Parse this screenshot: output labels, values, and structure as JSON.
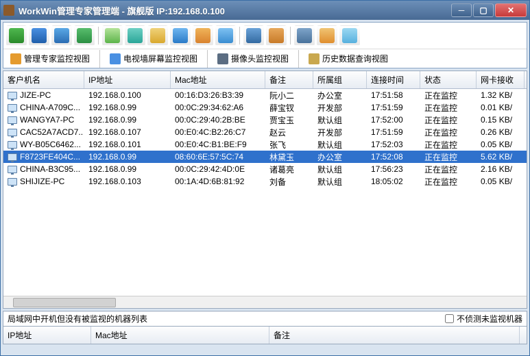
{
  "window": {
    "title": "WorkWin管理专家管理端 - 旗舰版 IP:192.168.0.100"
  },
  "toolbar_icons": [
    {
      "name": "desktop-icon",
      "color": "linear-gradient(#4fb84f,#2a8a2a)"
    },
    {
      "name": "screens-icon",
      "color": "linear-gradient(#4a90e2,#1f5eaa)"
    },
    {
      "name": "monitor-icon",
      "color": "linear-gradient(#5aa8e6,#2b6db3)"
    },
    {
      "name": "camera-icon",
      "color": "linear-gradient(#58bd6d,#2b8f42)"
    },
    {
      "name": "page-green-icon",
      "color": "linear-gradient(#b4e39a,#5db44a)"
    },
    {
      "name": "page-teal-icon",
      "color": "linear-gradient(#6ed0c4,#2aa598)"
    },
    {
      "name": "clipboard-icon",
      "color": "linear-gradient(#f0d27a,#d9a82e)"
    },
    {
      "name": "globe-icon",
      "color": "linear-gradient(#6fb6f0,#2a7bc7)"
    },
    {
      "name": "browser-icon",
      "color": "linear-gradient(#f0b45a,#d9822e)"
    },
    {
      "name": "search-icon",
      "color": "linear-gradient(#7ec1f2,#3a8dd1)"
    },
    {
      "name": "tv-icon",
      "color": "linear-gradient(#6aa2d8,#336aa1)"
    },
    {
      "name": "tools-icon",
      "color": "linear-gradient(#e7a85b,#c87a28)"
    },
    {
      "name": "disk-icon",
      "color": "linear-gradient(#7ea4c9,#49729b)"
    },
    {
      "name": "person-icon",
      "color": "linear-gradient(#f0c474,#e08e2e)"
    },
    {
      "name": "skin-icon",
      "color": "linear-gradient(#9cd9f2,#57b0de)"
    }
  ],
  "tabs": [
    {
      "icon": "expert-view-icon",
      "color": "#e59b2e",
      "label": "管理专家监控视图"
    },
    {
      "icon": "tvwall-view-icon",
      "color": "#4a90e2",
      "label": "电视墙屏幕监控视图"
    },
    {
      "icon": "camera-view-icon",
      "color": "#5b6d82",
      "label": "摄像头监控视图"
    },
    {
      "icon": "history-view-icon",
      "color": "#c9a84f",
      "label": "历史数据查询视图"
    }
  ],
  "columns": {
    "c0": "客户机名",
    "c1": "IP地址",
    "c2": "Mac地址",
    "c3": "备注",
    "c4": "所属组",
    "c5": "连接时间",
    "c6": "状态",
    "c7": "网卡接收"
  },
  "rows": [
    {
      "name": "JIZE-PC",
      "ip": "192.168.0.100",
      "mac": "00:16:D3:26:B3:39",
      "remark": "阮小二",
      "group": "办公室",
      "time": "17:51:58",
      "status": "正在监控",
      "rx": "1.32 KB/",
      "sel": false
    },
    {
      "name": "CHINA-A709C...",
      "ip": "192.168.0.99",
      "mac": "00:0C:29:34:62:A6",
      "remark": "薛宝钗",
      "group": "开发部",
      "time": "17:51:59",
      "status": "正在监控",
      "rx": "0.01 KB/",
      "sel": false
    },
    {
      "name": "WANGYA7-PC",
      "ip": "192.168.0.99",
      "mac": "00:0C:29:40:2B:BE",
      "remark": "贾宝玉",
      "group": "默认组",
      "time": "17:52:00",
      "status": "正在监控",
      "rx": "0.15 KB/",
      "sel": false
    },
    {
      "name": "CAC52A7ACD7...",
      "ip": "192.168.0.107",
      "mac": "00:E0:4C:B2:26:C7",
      "remark": "赵云",
      "group": "开发部",
      "time": "17:51:59",
      "status": "正在监控",
      "rx": "0.26 KB/",
      "sel": false
    },
    {
      "name": "WY-B05C6462...",
      "ip": "192.168.0.101",
      "mac": "00:E0:4C:B1:BE:F9",
      "remark": "张飞",
      "group": "默认组",
      "time": "17:52:03",
      "status": "正在监控",
      "rx": "0.05 KB/",
      "sel": false
    },
    {
      "name": "F8723FE404C...",
      "ip": "192.168.0.99",
      "mac": "08:60:6E:57:5C:74",
      "remark": "林黛玉",
      "group": "办公室",
      "time": "17:52:08",
      "status": "正在监控",
      "rx": "5.62 KB/",
      "sel": true
    },
    {
      "name": "CHINA-B3C95...",
      "ip": "192.168.0.99",
      "mac": "00:0C:29:42:4D:0E",
      "remark": "诸葛亮",
      "group": "默认组",
      "time": "17:56:23",
      "status": "正在监控",
      "rx": "2.16 KB/",
      "sel": false
    },
    {
      "name": "SHIJIZE-PC",
      "ip": "192.168.0.103",
      "mac": "00:1A:4D:6B:81:92",
      "remark": "刘备",
      "group": "默认组",
      "time": "18:05:02",
      "status": "正在监控",
      "rx": "0.05 KB/",
      "sel": false
    }
  ],
  "bottom": {
    "label": "局域网中开机但没有被监视的机器列表",
    "checkbox": "不侦测未监视机器",
    "cols": {
      "c0": "IP地址",
      "c1": "Mac地址",
      "c2": "备注"
    }
  }
}
